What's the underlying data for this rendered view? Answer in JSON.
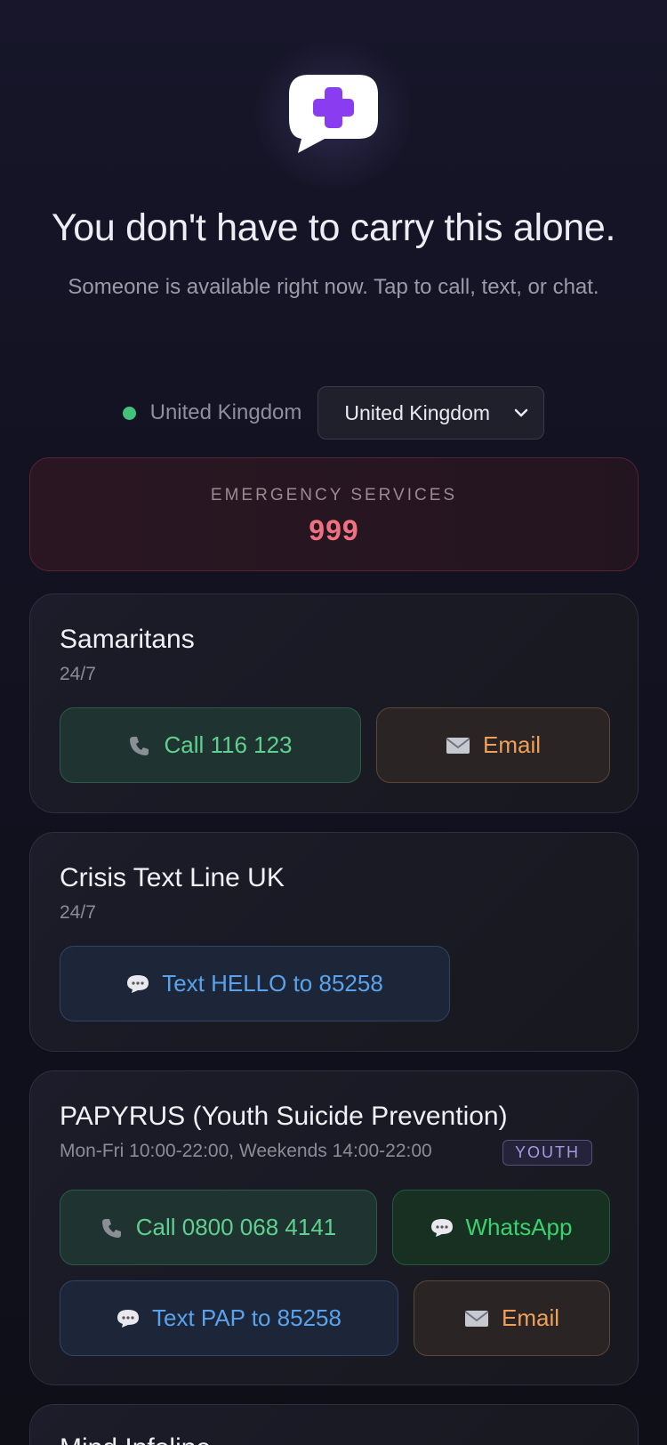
{
  "header": {
    "headline": "You don't have to carry this alone.",
    "subline": "Someone is available right now. Tap to call, text, or chat."
  },
  "country": {
    "label": "United Kingdom",
    "selected": "United Kingdom",
    "status_color": "#43c27c"
  },
  "emergency": {
    "label": "EMERGENCY SERVICES",
    "number": "999"
  },
  "services": [
    {
      "name": "Samaritans",
      "hours": "24/7",
      "buttons": [
        {
          "label": "Call 116 123",
          "icon": "phone-icon"
        },
        {
          "label": "Email",
          "icon": "email-icon"
        }
      ]
    },
    {
      "name": "Crisis Text Line UK",
      "hours": "24/7",
      "buttons": [
        {
          "label": "Text HELLO to 85258",
          "icon": "chat-icon"
        }
      ]
    },
    {
      "name": "PAPYRUS (Youth Suicide Prevention)",
      "hours": "Mon-Fri 10:00-22:00, Weekends 14:00-22:00",
      "badge": "YOUTH",
      "buttons": [
        {
          "label": "Call 0800 068 4141",
          "icon": "phone-icon"
        },
        {
          "label": "WhatsApp",
          "icon": "chat-icon"
        },
        {
          "label": "Text PAP to 85258",
          "icon": "chat-icon"
        },
        {
          "label": "Email",
          "icon": "email-icon"
        }
      ]
    },
    {
      "name": "Mind Infoline"
    }
  ],
  "colors": {
    "call": "#5fd08f",
    "email": "#eea05a",
    "text": "#5aa3ec",
    "whatsapp": "#3bd16e",
    "emergency": "#f07280",
    "badge": "#a39be0"
  }
}
